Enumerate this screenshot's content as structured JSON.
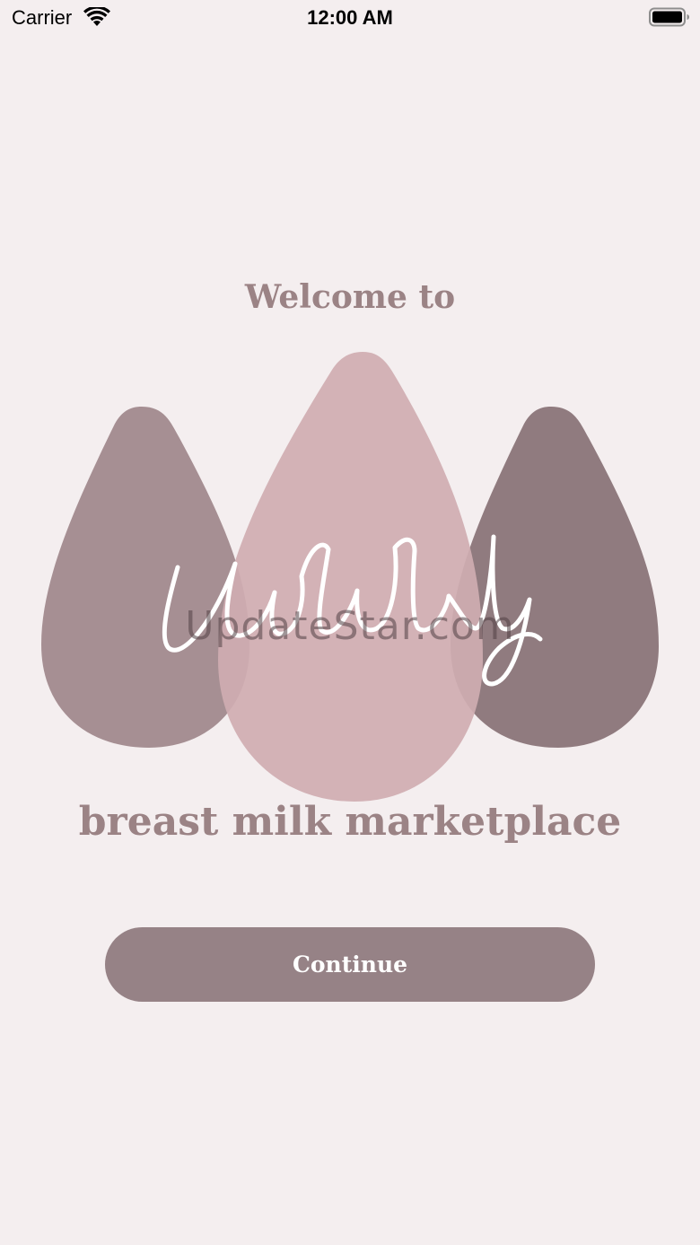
{
  "status_bar": {
    "carrier": "Carrier",
    "time": "12:00 AM",
    "wifi_icon": "wifi-icon",
    "battery_icon": "battery-icon"
  },
  "welcome": {
    "title": "Welcome to",
    "logo_text": "Udderly",
    "tagline": "breast milk marketplace",
    "watermark": "UpdateStar.com",
    "continue_label": "Continue"
  },
  "colors": {
    "background": "#f4eeef",
    "text_muted": "#9b8385",
    "button": "#968286",
    "drop_left": "#a68f93",
    "drop_center": "#cfadb1",
    "drop_right": "#907b7f"
  }
}
